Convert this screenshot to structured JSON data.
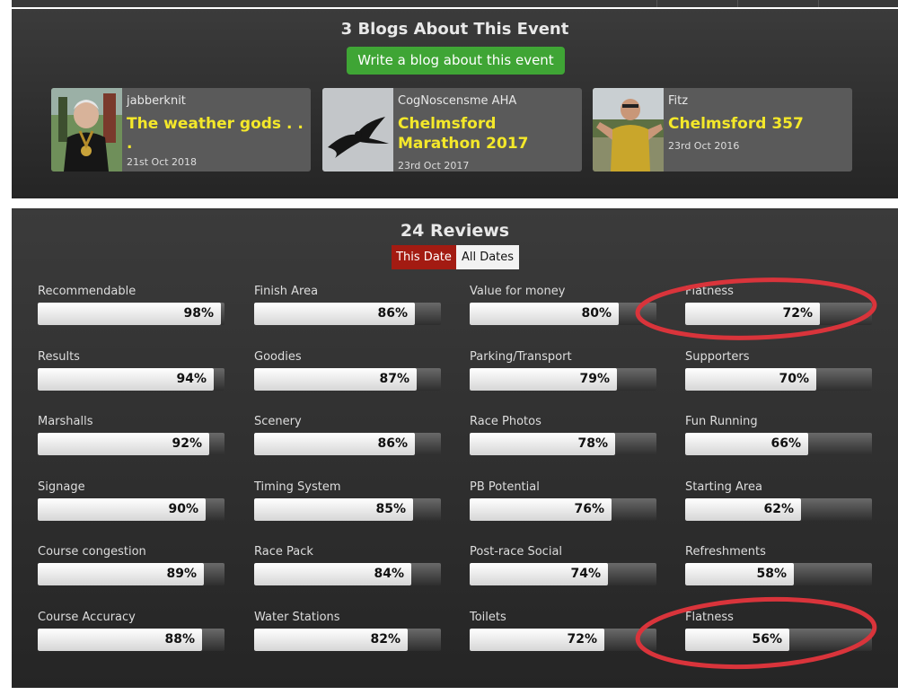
{
  "blogs": {
    "title": "3 Blogs About This Event",
    "write_button": "Write a blog about this event",
    "cards": [
      {
        "author": "jabberknit",
        "title": "The weather gods . . .",
        "date": "21st Oct 2018"
      },
      {
        "author": "CogNoscensme AHA",
        "title": "Chelmsford Marathon 2017",
        "date": "23rd Oct 2017"
      },
      {
        "author": "Fitz",
        "title": "Chelmsford 357",
        "date": "23rd Oct 2016"
      }
    ]
  },
  "reviews": {
    "title": "24 Reviews",
    "toggle_this": "This Date",
    "toggle_all": "All Dates",
    "metrics": [
      {
        "label": "Recommendable",
        "value": 98,
        "display": "98%"
      },
      {
        "label": "Results",
        "value": 94,
        "display": "94%"
      },
      {
        "label": "Marshalls",
        "value": 92,
        "display": "92%"
      },
      {
        "label": "Signage",
        "value": 90,
        "display": "90%"
      },
      {
        "label": "Course congestion",
        "value": 89,
        "display": "89%"
      },
      {
        "label": "Course Accuracy",
        "value": 88,
        "display": "88%"
      },
      {
        "label": "Finish Area",
        "value": 86,
        "display": "86%"
      },
      {
        "label": "Goodies",
        "value": 87,
        "display": "87%"
      },
      {
        "label": "Scenery",
        "value": 86,
        "display": "86%"
      },
      {
        "label": "Timing System",
        "value": 85,
        "display": "85%"
      },
      {
        "label": "Race Pack",
        "value": 84,
        "display": "84%"
      },
      {
        "label": "Water Stations",
        "value": 82,
        "display": "82%"
      },
      {
        "label": "Value for money",
        "value": 80,
        "display": "80%"
      },
      {
        "label": "Parking/Transport",
        "value": 79,
        "display": "79%"
      },
      {
        "label": "Race Photos",
        "value": 78,
        "display": "78%"
      },
      {
        "label": "PB Potential",
        "value": 76,
        "display": "76%"
      },
      {
        "label": "Post-race Social",
        "value": 74,
        "display": "74%"
      },
      {
        "label": "Toilets",
        "value": 72,
        "display": "72%"
      },
      {
        "label": "Flatness",
        "value": 72,
        "display": "72%"
      },
      {
        "label": "Supporters",
        "value": 70,
        "display": "70%"
      },
      {
        "label": "Fun Running",
        "value": 66,
        "display": "66%"
      },
      {
        "label": "Starting Area",
        "value": 62,
        "display": "62%"
      },
      {
        "label": "Refreshments",
        "value": 58,
        "display": "58%"
      },
      {
        "label": "Flatness",
        "value": 56,
        "display": "56%"
      }
    ]
  },
  "colors": {
    "accent_green": "#3fa535",
    "blog_title_yellow": "#f4e82a",
    "active_toggle": "#a31b12",
    "annotation_red": "#d9343b"
  }
}
